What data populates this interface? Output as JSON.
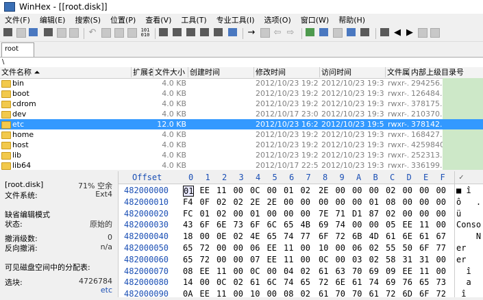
{
  "window": {
    "title": "WinHex - [[root.disk]]"
  },
  "menu": [
    "文件(F)",
    "编辑(E)",
    "搜索(S)",
    "位置(P)",
    "查看(V)",
    "工具(T)",
    "专业工具(I)",
    "选项(O)",
    "窗口(W)",
    "帮助(H)"
  ],
  "toolbar": {
    "icons": [
      "disk-icon",
      "open-icon",
      "save-icon",
      "print-icon",
      "properties-icon",
      "undo-icon",
      "copy-icon",
      "paste-icon",
      "fill-icon",
      "hex-convert-icon",
      "find-icon",
      "find-hex-icon",
      "replace-icon",
      "replace-hex-icon",
      "find-next-icon",
      "goto-icon",
      "goto-offset-icon",
      "back-icon",
      "forward-icon",
      "disk-editor-icon",
      "ram-editor-icon",
      "calculator-icon",
      "drive-icon",
      "monitor-icon",
      "tools-icon",
      "prev-icon",
      "next-icon",
      "window-icon",
      "help-icon"
    ]
  },
  "tabs": [
    {
      "label": "root"
    }
  ],
  "path": "\\",
  "file_list": {
    "columns": [
      "文件名称",
      "扩展名",
      "文件大小",
      "创建时间",
      "修改时间",
      "访问时间",
      "文件属性",
      "内部上级目录号"
    ],
    "rows": [
      {
        "name": "bin",
        "ext": "",
        "size": "4.0 KB",
        "created": "",
        "modified": "2012/10/23  19:2...",
        "accessed": "2012/10/23  19:3...",
        "attr": "rwxr-...",
        "parent": "294256..."
      },
      {
        "name": "boot",
        "ext": "",
        "size": "4.0 KB",
        "created": "",
        "modified": "2012/10/23  19:2...",
        "accessed": "2012/10/23  19:3...",
        "attr": "rwxr-...",
        "parent": "126484..."
      },
      {
        "name": "cdrom",
        "ext": "",
        "size": "4.0 KB",
        "created": "",
        "modified": "2012/10/23  19:2...",
        "accessed": "2012/10/23  19:3...",
        "attr": "rwxr-...",
        "parent": "378175..."
      },
      {
        "name": "dev",
        "ext": "",
        "size": "4.0 KB",
        "created": "",
        "modified": "2012/10/17  23:0...",
        "accessed": "2012/10/23  19:3...",
        "attr": "rwxr-...",
        "parent": "210370..."
      },
      {
        "name": "etc",
        "ext": "",
        "size": "12.0 KB",
        "created": "",
        "modified": "2012/10/23  16:2...",
        "accessed": "2012/10/23  19:5...",
        "attr": "rwxr-...",
        "parent": "378142...",
        "selected": true
      },
      {
        "name": "home",
        "ext": "",
        "size": "4.0 KB",
        "created": "",
        "modified": "2012/10/23  19:2...",
        "accessed": "2012/10/23  19:3...",
        "attr": "rwxr-...",
        "parent": "168427..."
      },
      {
        "name": "host",
        "ext": "",
        "size": "4.0 KB",
        "created": "",
        "modified": "2012/10/23  19:2...",
        "accessed": "2012/10/23  19:3...",
        "attr": "rwxr-...",
        "parent": "4259840"
      },
      {
        "name": "lib",
        "ext": "",
        "size": "4.0 KB",
        "created": "",
        "modified": "2012/10/23  19:2...",
        "accessed": "2012/10/23  19:3...",
        "attr": "rwxr-...",
        "parent": "252313..."
      },
      {
        "name": "lib64",
        "ext": "",
        "size": "4.0 KB",
        "created": "",
        "modified": "2012/10/17  22:5...",
        "accessed": "2012/10/23  19:3...",
        "attr": "rwxr-...",
        "parent": "336199..."
      }
    ]
  },
  "status": {
    "disk_label": "[root.disk]",
    "free_pct": "71% 空余",
    "fs_label": "文件系统:",
    "fs_value": "Ext4",
    "edit_mode_label": "缺省编辑模式",
    "state_label": "状态:",
    "state_value": "原始的",
    "undo_level_label": "撤消级数:",
    "undo_level_value": "0",
    "redo_label": "反向撤消:",
    "redo_value": "n/a",
    "alloc_label": "可见磁盘空间中的分配表:",
    "block_label": "选块:",
    "block_value": "4726784",
    "block_sub": "etc"
  },
  "hex": {
    "offset_label": "Offset",
    "columns": [
      "0",
      "1",
      "2",
      "3",
      "4",
      "5",
      "6",
      "7",
      "8",
      "9",
      "A",
      "B",
      "C",
      "D",
      "E",
      "F"
    ],
    "rows": [
      {
        "offset": "482000000",
        "bytes": [
          "01",
          "EE",
          "11",
          "00",
          "0C",
          "00",
          "01",
          "02",
          "2E",
          "00",
          "00",
          "00",
          "02",
          "00",
          "00",
          "00"
        ]
      },
      {
        "offset": "482000010",
        "bytes": [
          "F4",
          "0F",
          "02",
          "02",
          "2E",
          "2E",
          "00",
          "00",
          "00",
          "00",
          "00",
          "01",
          "08",
          "00",
          "00",
          "00"
        ]
      },
      {
        "offset": "482000020",
        "bytes": [
          "FC",
          "01",
          "02",
          "00",
          "01",
          "00",
          "00",
          "00",
          "7E",
          "71",
          "D1",
          "87",
          "02",
          "00",
          "00",
          "00"
        ]
      },
      {
        "offset": "482000030",
        "bytes": [
          "43",
          "6F",
          "6E",
          "73",
          "6F",
          "6C",
          "65",
          "4B",
          "69",
          "74",
          "00",
          "00",
          "05",
          "EE",
          "11",
          "00"
        ]
      },
      {
        "offset": "482000040",
        "bytes": [
          "18",
          "00",
          "0E",
          "02",
          "4E",
          "65",
          "74",
          "77",
          "6F",
          "72",
          "6B",
          "4D",
          "61",
          "6E",
          "61",
          "67"
        ]
      },
      {
        "offset": "482000050",
        "bytes": [
          "65",
          "72",
          "00",
          "00",
          "06",
          "EE",
          "11",
          "00",
          "10",
          "00",
          "06",
          "02",
          "55",
          "50",
          "6F",
          "77"
        ]
      },
      {
        "offset": "482000060",
        "bytes": [
          "65",
          "72",
          "00",
          "00",
          "07",
          "EE",
          "11",
          "00",
          "0C",
          "00",
          "03",
          "02",
          "58",
          "31",
          "31",
          "00"
        ]
      },
      {
        "offset": "482000070",
        "bytes": [
          "08",
          "EE",
          "11",
          "00",
          "0C",
          "00",
          "04",
          "02",
          "61",
          "63",
          "70",
          "69",
          "09",
          "EE",
          "11",
          "00"
        ]
      },
      {
        "offset": "482000080",
        "bytes": [
          "14",
          "00",
          "0C",
          "02",
          "61",
          "6C",
          "74",
          "65",
          "72",
          "6E",
          "61",
          "74",
          "69",
          "76",
          "65",
          "73"
        ]
      },
      {
        "offset": "482000090",
        "bytes": [
          "0A",
          "EE",
          "11",
          "00",
          "10",
          "00",
          "08",
          "02",
          "61",
          "70",
          "70",
          "61",
          "72",
          "6D",
          "6F",
          "72"
        ]
      }
    ]
  },
  "text_column": {
    "header": "✓",
    "lines": [
      "■ î",
      "ô   .",
      "ü",
      "Conso",
      "    N",
      "er",
      "er",
      "  î",
      "  a",
      " î"
    ]
  }
}
